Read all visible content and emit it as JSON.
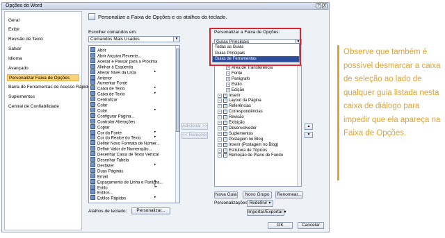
{
  "window": {
    "title": "Opções do Word",
    "help_btn": "?",
    "close_btn": "X"
  },
  "nav": {
    "items": [
      {
        "label": "Geral",
        "selected": false
      },
      {
        "label": "Exibir",
        "selected": false
      },
      {
        "label": "Revisão de Texto",
        "selected": false
      },
      {
        "label": "Salvar",
        "selected": false
      },
      {
        "label": "Idioma",
        "selected": false
      },
      {
        "label": "Avançado",
        "selected": false
      },
      {
        "label": "Personalizar Faixa de Opções",
        "selected": true
      },
      {
        "label": "Barra de Ferramentas de Acesso Rápido",
        "selected": false
      },
      {
        "label": "Suplementos",
        "selected": false
      },
      {
        "label": "Central de Confiabilidade",
        "selected": false
      }
    ]
  },
  "header": {
    "text": "Personalize a Faixa de Opções e os atalhos do teclado."
  },
  "left_panel": {
    "choose_label": "Escolher comandos em:",
    "choose_value": "Comandos Mais Usados",
    "commands": [
      {
        "label": "Abrir",
        "sub": ""
      },
      {
        "label": "Abrir Arquivo Recente...",
        "sub": ""
      },
      {
        "label": "Aceitar e Passar para a Próxima",
        "sub": ""
      },
      {
        "label": "Alinhar à Esquerda",
        "sub": ""
      },
      {
        "label": "Alterar Nível da Lista",
        "sub": "▸"
      },
      {
        "label": "Anterior",
        "sub": ""
      },
      {
        "label": "Aumentar Fonte",
        "sub": ""
      },
      {
        "label": "Caixa de Texto",
        "sub": "▸"
      },
      {
        "label": "Caixa de Texto",
        "sub": "▸"
      },
      {
        "label": "Centralizar",
        "sub": ""
      },
      {
        "label": "Colar",
        "sub": ""
      },
      {
        "label": "Colar",
        "sub": "▸"
      },
      {
        "label": "Configurar Página...",
        "sub": ""
      },
      {
        "label": "Controlar Alterações",
        "sub": ""
      },
      {
        "label": "Copiar",
        "sub": ""
      },
      {
        "label": "Cor da Fonte",
        "sub": "▸"
      },
      {
        "label": "Cor do Realce do Texto",
        "sub": "▸"
      },
      {
        "label": "Definir Novo Formato de Númer...",
        "sub": ""
      },
      {
        "label": "Definir Valor de Numeração...",
        "sub": ""
      },
      {
        "label": "Desenhar Caixa de Texto Vertical",
        "sub": ""
      },
      {
        "label": "Desenhar Tabela",
        "sub": ""
      },
      {
        "label": "Desfazer",
        "sub": "▸"
      },
      {
        "label": "Duas Páginas",
        "sub": ""
      },
      {
        "label": "Email",
        "sub": ""
      },
      {
        "label": "Espaçamento de Linha e Parágra...",
        "sub": "▸"
      },
      {
        "label": "Estilo",
        "sub": "I▸"
      },
      {
        "label": "Estilos...",
        "sub": ""
      },
      {
        "label": "Estilos Rápidos",
        "sub": "▸"
      }
    ],
    "shortcuts_label": "Atalhos de teclado:",
    "customize_btn": "Personalizar..."
  },
  "middle": {
    "add_btn": "Adicionar >>",
    "remove_btn": "<< Remover"
  },
  "right_panel": {
    "customize_label": "Personalizar a Faixa de Opções:",
    "combo_value": "Guias Principais",
    "dropdown_options": [
      {
        "label": "Todas as Guias",
        "selected": false
      },
      {
        "label": "Guias Principais",
        "selected": false
      },
      {
        "label": "Guias de Ferramentas",
        "selected": true
      }
    ],
    "tree": [
      {
        "label": "Área de Transferência",
        "indent": 2,
        "exp": "+",
        "check": false
      },
      {
        "label": "Fonte",
        "indent": 2,
        "exp": "+",
        "check": false
      },
      {
        "label": "Parágrafo",
        "indent": 2,
        "exp": "+",
        "check": false
      },
      {
        "label": "Estilo",
        "indent": 2,
        "exp": "+",
        "check": false
      },
      {
        "label": "Edição",
        "indent": 2,
        "exp": "+",
        "check": false
      },
      {
        "label": "Inserir",
        "indent": 1,
        "exp": "+",
        "check": true
      },
      {
        "label": "Layout da Página",
        "indent": 1,
        "exp": "+",
        "check": true
      },
      {
        "label": "Referências",
        "indent": 1,
        "exp": "+",
        "check": true
      },
      {
        "label": "Correspondências",
        "indent": 1,
        "exp": "+",
        "check": true
      },
      {
        "label": "Revisão",
        "indent": 1,
        "exp": "+",
        "check": true
      },
      {
        "label": "Exibição",
        "indent": 1,
        "exp": "+",
        "check": true
      },
      {
        "label": "Desenvolvedor",
        "indent": 1,
        "exp": "+",
        "check": true
      },
      {
        "label": "Suplementos",
        "indent": 1,
        "exp": "+",
        "check": true
      },
      {
        "label": "Postagem no Blog",
        "indent": 1,
        "exp": "+",
        "check": true
      },
      {
        "label": "Inserir (Postagem no Blog)",
        "indent": 1,
        "exp": "+",
        "check": true
      },
      {
        "label": "Estrutura de Tópicos",
        "indent": 1,
        "exp": "+",
        "check": true
      },
      {
        "label": "Remoção de Plano de Fundo",
        "indent": 1,
        "exp": "+",
        "check": true
      }
    ],
    "new_tab_btn": "Nova Guia",
    "new_group_btn": "Novo Grupo",
    "rename_btn": "Renomear...",
    "personalizations_label": "Personalizações:",
    "reset_btn": "Redefinir ▾",
    "import_export_btn": "Importar/Exportar ▾"
  },
  "footer": {
    "ok": "OK",
    "cancel": "Cancelar"
  },
  "callout": {
    "text": "Observe que também é possível desmarcar a caixa de seleção ao lado de qualquer guia listada nesta caixa de diálogo para impedir que ela apareça na Faixa de Opções."
  },
  "colors": {
    "selection": "#fbd37a",
    "accent_orange": "#e1a234",
    "highlight_red": "#e0232b",
    "dropdown_sel": "#2c4d9c"
  }
}
